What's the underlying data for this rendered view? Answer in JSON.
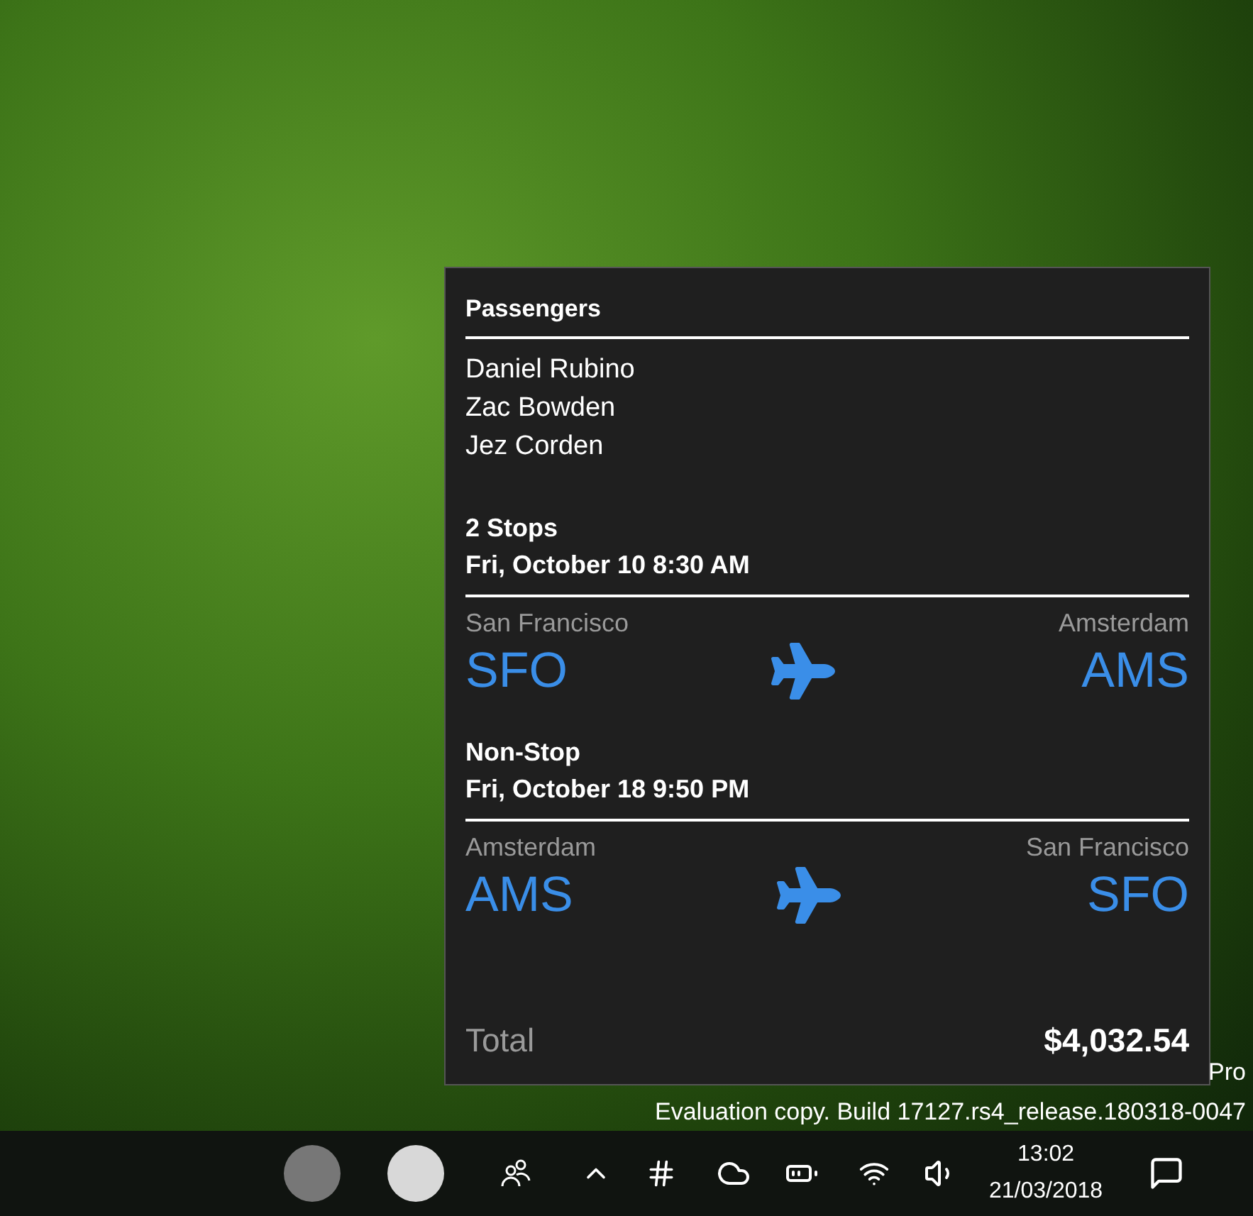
{
  "passengers": {
    "title": "Passengers",
    "names": [
      "Daniel Rubino",
      "Zac Bowden",
      "Jez Corden"
    ]
  },
  "flights": [
    {
      "stops": "2 Stops",
      "date": "Fri, October 10 8:30 AM",
      "origin": {
        "city": "San Francisco",
        "code": "SFO"
      },
      "destination": {
        "city": "Amsterdam",
        "code": "AMS"
      }
    },
    {
      "stops": "Non-Stop",
      "date": "Fri, October 18 9:50 PM",
      "origin": {
        "city": "Amsterdam",
        "code": "AMS"
      },
      "destination": {
        "city": "San Francisco",
        "code": "SFO"
      }
    }
  ],
  "total": {
    "label": "Total",
    "amount": "$4,032.54"
  },
  "watermark": [
    "Pro",
    "Evaluation copy. Build 17127.rs4_release.180318-0047"
  ],
  "taskbar": {
    "time": "13:02",
    "date": "21/03/2018"
  }
}
